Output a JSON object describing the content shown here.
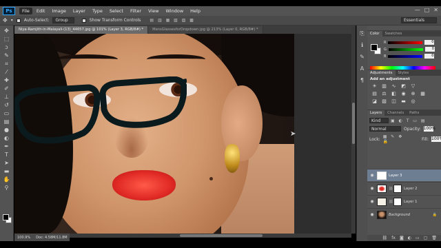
{
  "menubar": {
    "app_badge": "Ps",
    "items": [
      "File",
      "Edit",
      "Image",
      "Layer",
      "Type",
      "Select",
      "Filter",
      "View",
      "Window",
      "Help"
    ],
    "window_buttons": [
      "—",
      "□",
      "✕"
    ]
  },
  "options": {
    "auto_select_label": "Auto-Select:",
    "auto_select_value": "Group",
    "transform_label": "Show Transform Controls",
    "workspace": "Essentials"
  },
  "tabs": [
    {
      "label": "Niya-Ramjith-in-Malayali-(13)_44657.jpg @ 101% (Layer 3, RGB/8#) *",
      "active": true
    },
    {
      "label": "MensGlassesforDropdown.jpg @ 213% (Layer 0, RGB/8#) *",
      "active": false
    }
  ],
  "status": {
    "zoom": "100.9%",
    "doc": "Doc: 4.58M/11.8M"
  },
  "color_panel": {
    "tabs": [
      "Color",
      "Swatches"
    ],
    "rows": [
      {
        "label": "R",
        "value": "0"
      },
      {
        "label": "G",
        "value": "0"
      },
      {
        "label": "B",
        "value": "0"
      }
    ]
  },
  "adjustments": {
    "tabs": [
      "Adjustments",
      "Styles"
    ],
    "title": "Add an adjustment"
  },
  "layers_panel": {
    "tabs": [
      "Layers",
      "Channels",
      "Paths"
    ],
    "filter": "Kind",
    "blend_mode": "Normal",
    "opacity_label": "Opacity:",
    "opacity": "100%",
    "lock_label": "Lock:",
    "fill_label": "Fill:",
    "fill": "100%",
    "layers": [
      {
        "name": "Layer 3",
        "selected": true,
        "has_mask": false
      },
      {
        "name": "Layer 2",
        "selected": false,
        "has_mask": true
      },
      {
        "name": "Layer 1",
        "selected": false,
        "has_mask": true
      },
      {
        "name": "Background",
        "selected": false,
        "has_mask": false
      }
    ]
  }
}
